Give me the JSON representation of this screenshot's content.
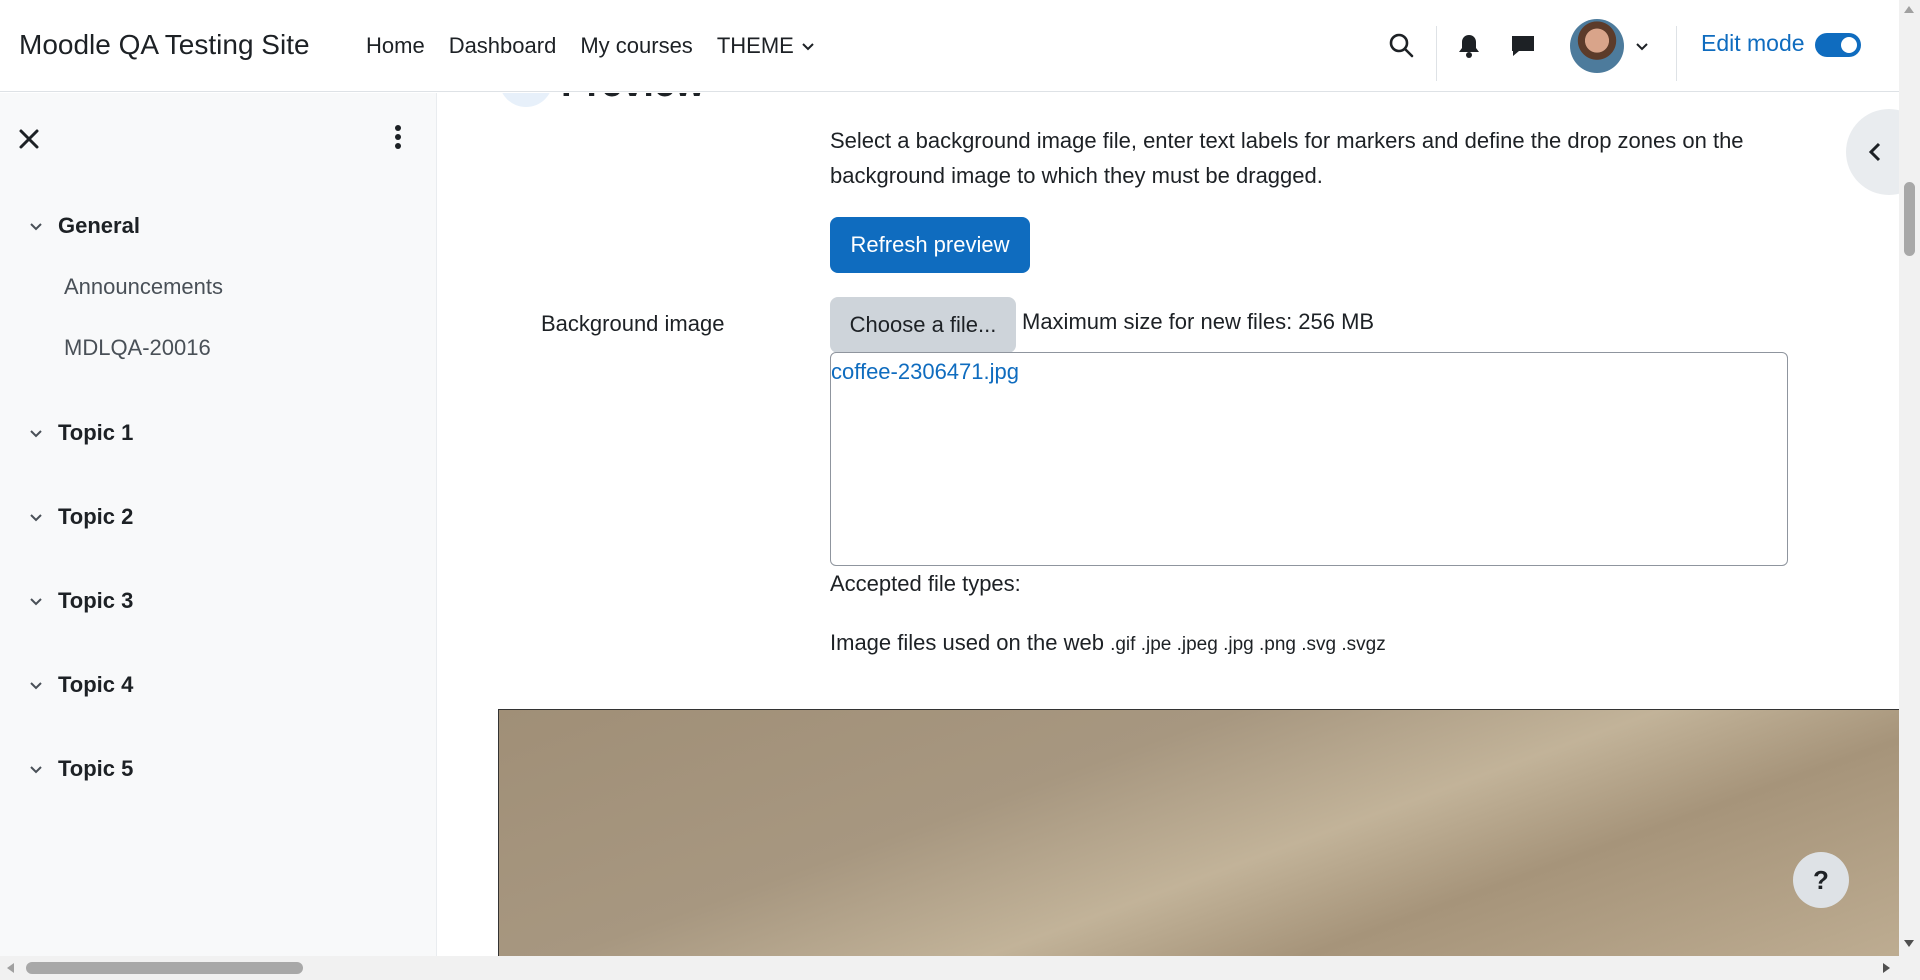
{
  "navbar": {
    "site_name": "Moodle QA Testing Site",
    "links": [
      "Home",
      "Dashboard",
      "My courses",
      "THEME"
    ],
    "edit_mode_label": "Edit mode",
    "edit_mode_on": true
  },
  "drawer": {
    "sections": [
      {
        "label": "General",
        "activities": [
          "Announcements",
          "MDLQA-20016"
        ]
      },
      {
        "label": "Topic 1"
      },
      {
        "label": "Topic 2"
      },
      {
        "label": "Topic 3"
      },
      {
        "label": "Topic 4"
      },
      {
        "label": "Topic 5"
      }
    ]
  },
  "main": {
    "heading": "Preview",
    "description": "Select a background image file, enter text labels for markers and define the drop zones on the background image to which they must be dragged.",
    "refresh_button": "Refresh preview",
    "background_label": "Background image",
    "choose_file_button": "Choose a file...",
    "max_size": "Maximum size for new files: 256 MB",
    "file_name": "coffee-2306471.jpg",
    "accepted_label": "Accepted file types:",
    "filetypes_label": "Image files used on the web",
    "filetypes_ext": ".gif .jpe .jpeg .jpg .png .svg .svgz"
  },
  "help_label": "?",
  "colors": {
    "primary": "#0f6cbf",
    "drawer_bg": "#f8f9fa"
  }
}
